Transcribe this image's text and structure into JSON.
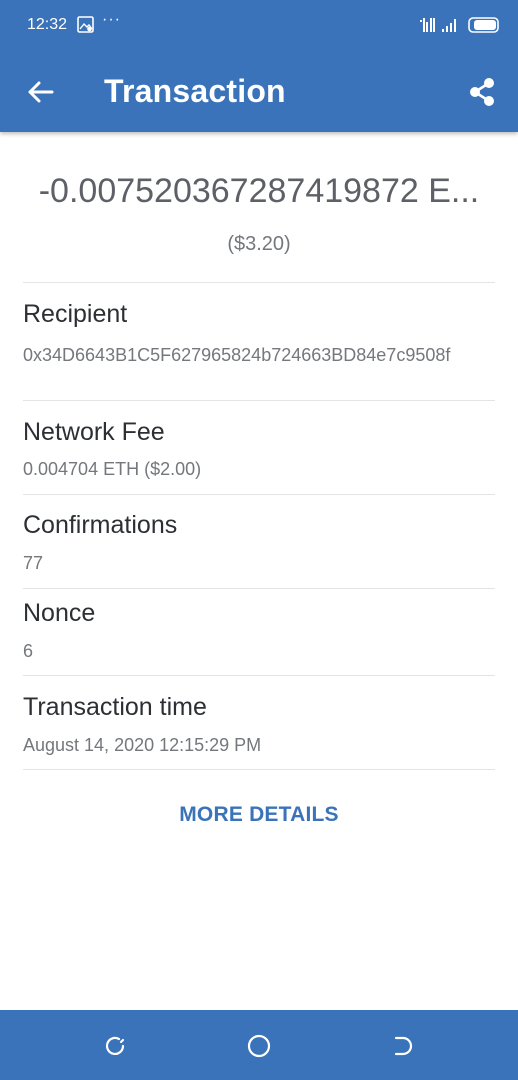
{
  "status_bar": {
    "time": "12:32",
    "image_icon": "image-icon",
    "more_icon": "ellipsis-icon",
    "dots": "···",
    "signal_icon": "signal-icon",
    "battery_icon": "battery-icon"
  },
  "app_bar": {
    "title": "Transaction",
    "back_icon": "arrow-left-icon",
    "share_icon": "share-icon",
    "color": "#3a73b9"
  },
  "amount": {
    "crypto": "-0.007520367287419872 E...",
    "fiat": "($3.20)"
  },
  "details": [
    {
      "label": "Recipient",
      "value": "0x34D6643B1C5F627965824b724663BD84e7c9508f"
    },
    {
      "label": "Network Fee",
      "value": "0.004704 ETH ($2.00)"
    },
    {
      "label": "Confirmations",
      "value": "77"
    },
    {
      "label": "Nonce",
      "value": "6"
    },
    {
      "label": "Transaction time",
      "value": "August 14, 2020 12:15:29 PM"
    }
  ],
  "more_details_label": "MORE DETAILS",
  "nav_bar": {
    "recents_icon": "recents-icon",
    "home_icon": "home-circle-icon",
    "back_icon": "nav-back-icon"
  }
}
